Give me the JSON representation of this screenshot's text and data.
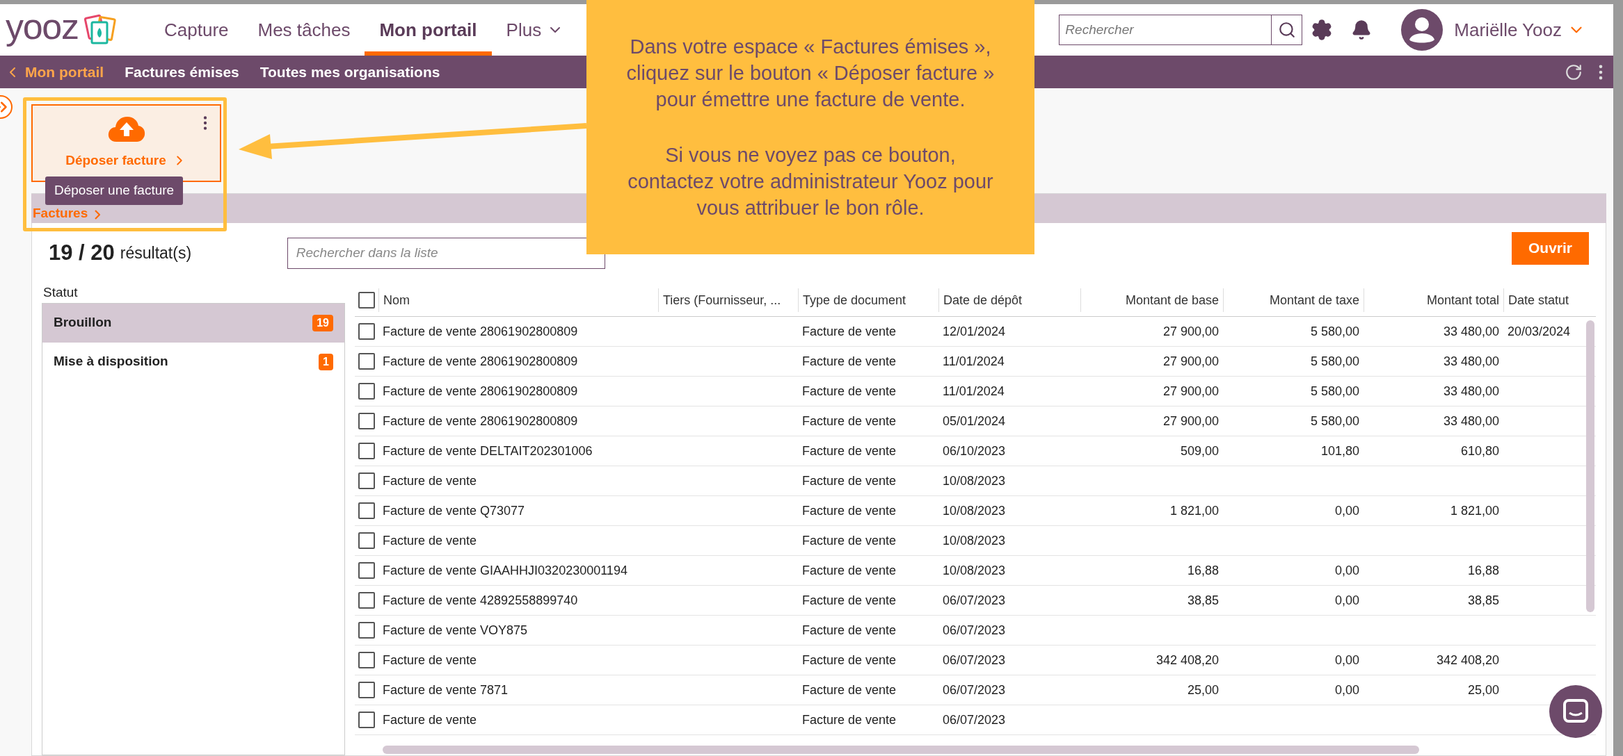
{
  "header": {
    "logo": "yooz",
    "nav": [
      {
        "label": "Capture",
        "selected": false
      },
      {
        "label": "Mes tâches",
        "selected": false
      },
      {
        "label": "Mon portail",
        "selected": true
      },
      {
        "label": "Plus",
        "selected": false,
        "dropdown": true
      }
    ],
    "search": {
      "placeholder": "Rechercher"
    },
    "user": "Mariëlle Yooz"
  },
  "subnav": {
    "back": "Mon portail",
    "items": [
      "Factures émises",
      "Toutes mes organisations"
    ]
  },
  "tile": {
    "label": "Déposer facture",
    "tooltip": "Déposer une facture"
  },
  "section": {
    "title": "Factures"
  },
  "results": {
    "count": "19 / 20",
    "label": "résultat(s)"
  },
  "list_search": {
    "placeholder": "Rechercher dans la liste"
  },
  "open_button": "Ouvrir",
  "status": {
    "title": "Statut",
    "items": [
      {
        "label": "Brouillon",
        "count": "19",
        "selected": true
      },
      {
        "label": "Mise à disposition",
        "count": "1",
        "selected": false
      }
    ]
  },
  "table": {
    "columns": [
      "Nom",
      "Tiers (Fournisseur, ...",
      "Type de document",
      "Date de dépôt",
      "Montant de base",
      "Montant de taxe",
      "Montant total",
      "Date statut"
    ],
    "select_all_checked": false,
    "rows": [
      {
        "checked": false,
        "cells": [
          "Facture de vente 28061902800809",
          "",
          "Facture de vente",
          "12/01/2024",
          "27 900,00",
          "5 580,00",
          "33 480,00",
          "20/03/2024"
        ]
      },
      {
        "checked": false,
        "cells": [
          "Facture de vente 28061902800809",
          "",
          "Facture de vente",
          "11/01/2024",
          "27 900,00",
          "5 580,00",
          "33 480,00",
          ""
        ]
      },
      {
        "checked": false,
        "cells": [
          "Facture de vente 28061902800809",
          "",
          "Facture de vente",
          "11/01/2024",
          "27 900,00",
          "5 580,00",
          "33 480,00",
          ""
        ]
      },
      {
        "checked": false,
        "cells": [
          "Facture de vente 28061902800809",
          "",
          "Facture de vente",
          "05/01/2024",
          "27 900,00",
          "5 580,00",
          "33 480,00",
          ""
        ]
      },
      {
        "checked": false,
        "cells": [
          "Facture de vente DELTAIT202301006",
          "",
          "Facture de vente",
          "06/10/2023",
          "509,00",
          "101,80",
          "610,80",
          ""
        ]
      },
      {
        "checked": false,
        "cells": [
          "Facture de vente",
          "",
          "Facture de vente",
          "10/08/2023",
          "",
          "",
          "",
          ""
        ]
      },
      {
        "checked": false,
        "cells": [
          "Facture de vente Q73077",
          "",
          "Facture de vente",
          "10/08/2023",
          "1 821,00",
          "0,00",
          "1 821,00",
          ""
        ]
      },
      {
        "checked": false,
        "cells": [
          "Facture de vente",
          "",
          "Facture de vente",
          "10/08/2023",
          "",
          "",
          "",
          ""
        ]
      },
      {
        "checked": false,
        "cells": [
          "Facture de vente GIAAHHJI0320230001194",
          "",
          "Facture de vente",
          "10/08/2023",
          "16,88",
          "0,00",
          "16,88",
          ""
        ]
      },
      {
        "checked": false,
        "cells": [
          "Facture de vente 42892558899740",
          "",
          "Facture de vente",
          "06/07/2023",
          "38,85",
          "0,00",
          "38,85",
          ""
        ]
      },
      {
        "checked": false,
        "cells": [
          "Facture de vente VOY875",
          "",
          "Facture de vente",
          "06/07/2023",
          "",
          "",
          "",
          ""
        ]
      },
      {
        "checked": false,
        "cells": [
          "Facture de vente",
          "",
          "Facture de vente",
          "06/07/2023",
          "342 408,20",
          "0,00",
          "342 408,20",
          ""
        ]
      },
      {
        "checked": false,
        "cells": [
          "Facture de vente 7871",
          "",
          "Facture de vente",
          "06/07/2023",
          "25,00",
          "0,00",
          "25,00",
          ""
        ]
      },
      {
        "checked": false,
        "cells": [
          "Facture de vente",
          "",
          "Facture de vente",
          "06/07/2023",
          "",
          "",
          "",
          ""
        ]
      }
    ]
  },
  "callout": {
    "paragraphs": [
      "Dans votre espace « Factures émises », cliquez sur le bouton « Déposer facture » pour émettre une facture de vente.",
      "Si vous ne voyez pas ce bouton, contactez votre administrateur Yooz pour vous attribuer le bon rôle."
    ]
  }
}
